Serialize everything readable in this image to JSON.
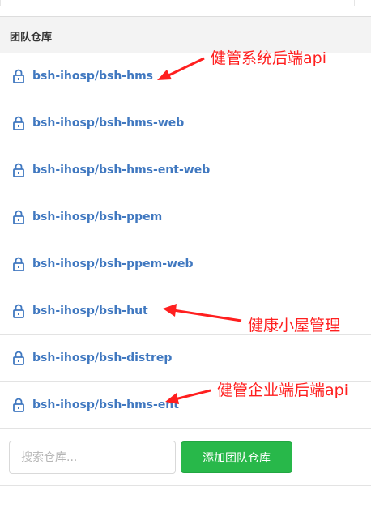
{
  "panel": {
    "title": "团队仓库"
  },
  "repos": [
    {
      "name": "bsh-ihosp/bsh-hms"
    },
    {
      "name": "bsh-ihosp/bsh-hms-web"
    },
    {
      "name": "bsh-ihosp/bsh-hms-ent-web"
    },
    {
      "name": "bsh-ihosp/bsh-ppem"
    },
    {
      "name": "bsh-ihosp/bsh-ppem-web"
    },
    {
      "name": "bsh-ihosp/bsh-hut"
    },
    {
      "name": "bsh-ihosp/bsh-distrep"
    },
    {
      "name": "bsh-ihosp/bsh-hms-ent"
    }
  ],
  "annotations": [
    {
      "text": "健管系统后端api"
    },
    {
      "text": "健康小屋管理"
    },
    {
      "text": "健管企业端后端api"
    }
  ],
  "search": {
    "placeholder": "搜索仓库..."
  },
  "actions": {
    "add_label": "添加团队仓库"
  },
  "colors": {
    "link": "#4078c0",
    "annotation": "#ff1f1f",
    "button": "#28b84a",
    "header_bg": "#f3f3f3"
  },
  "icons": {
    "repo": "lock-icon",
    "annotation_pointer": "red-arrow-icon"
  }
}
